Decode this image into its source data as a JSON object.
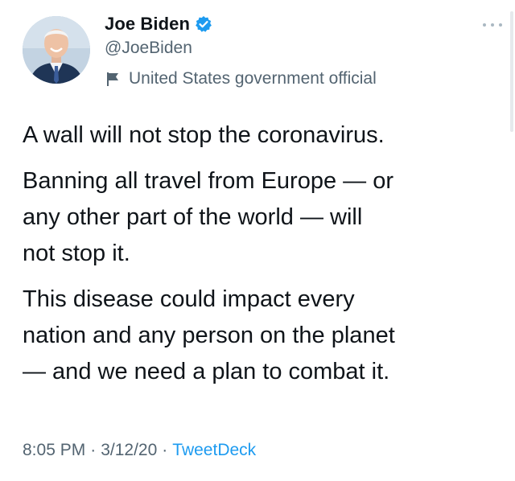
{
  "author": {
    "display_name": "Joe Biden",
    "handle": "@JoeBiden",
    "label": "United States government official",
    "verified": true
  },
  "tweet": {
    "paragraphs": [
      "A wall will not stop the coronavirus.",
      "Banning all travel from Europe — or\nany other part of the world — will\nnot stop it.",
      "This disease could impact every\nnation and any person on the planet\n— and we need a plan to combat it."
    ],
    "time": "8:05 PM",
    "date": "3/12/20",
    "source": "TweetDeck",
    "separator": "·"
  },
  "colors": {
    "text": "#0f1419",
    "secondary": "#536471",
    "link": "#1d9bf0",
    "verified": "#1d9bf0"
  },
  "icons": {
    "verified": "verified-badge-icon",
    "label": "flag-icon",
    "more": "more-options-icon"
  }
}
